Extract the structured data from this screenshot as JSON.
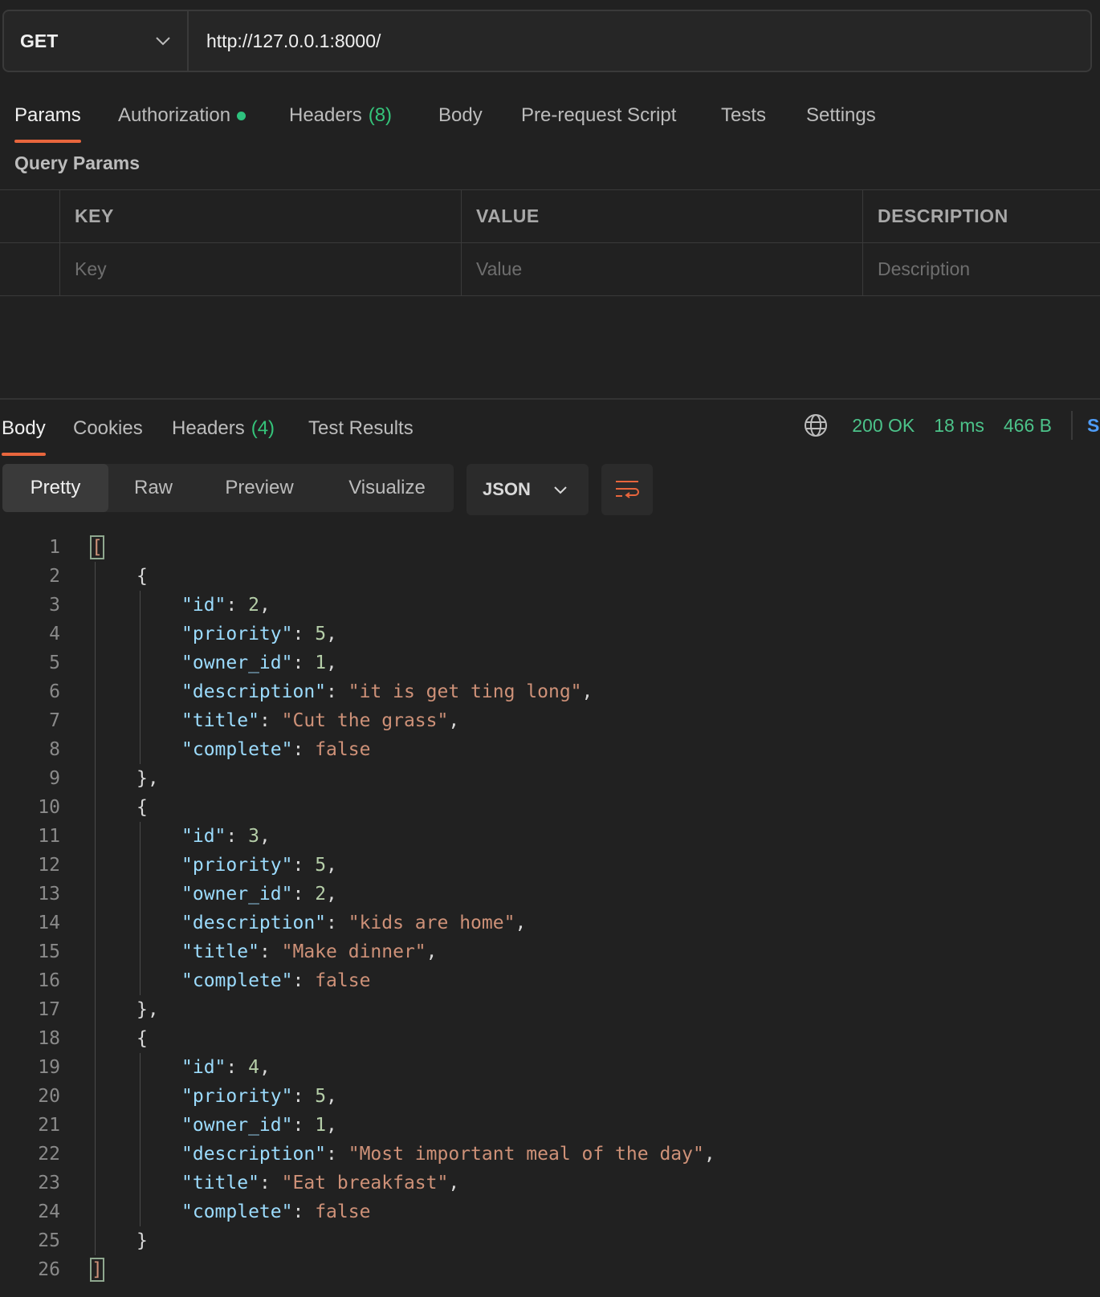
{
  "request": {
    "method": "GET",
    "url": "http://127.0.0.1:8000/"
  },
  "request_tabs": [
    {
      "label": "Params",
      "active": true
    },
    {
      "label": "Authorization",
      "dot": true
    },
    {
      "label": "Headers",
      "count": "(8)"
    },
    {
      "label": "Body"
    },
    {
      "label": "Pre-request Script"
    },
    {
      "label": "Tests"
    },
    {
      "label": "Settings"
    }
  ],
  "query_params": {
    "title": "Query Params",
    "columns": [
      "KEY",
      "VALUE",
      "DESCRIPTION"
    ],
    "placeholders": {
      "key": "Key",
      "value": "Value",
      "description": "Description"
    }
  },
  "response_tabs": [
    {
      "label": "Body",
      "active": true
    },
    {
      "label": "Cookies"
    },
    {
      "label": "Headers",
      "count": "(4)"
    },
    {
      "label": "Test Results"
    }
  ],
  "response_status": {
    "status": "200 OK",
    "time": "18 ms",
    "size": "466 B",
    "save": "S",
    "icon": "globe-icon"
  },
  "view_modes": [
    "Pretty",
    "Raw",
    "Preview",
    "Visualize"
  ],
  "active_view": "Pretty",
  "format": "JSON",
  "colors": {
    "accent": "#e8663d",
    "status_green": "#4cc38a",
    "key": "#9cdcfe",
    "number": "#b5cea8",
    "string": "#ce9178",
    "link": "#4f9cf6"
  },
  "response_body": [
    {
      "id": 2,
      "priority": 5,
      "owner_id": 1,
      "description": "it is get ting long",
      "title": "Cut the grass",
      "complete": "false"
    },
    {
      "id": 3,
      "priority": 5,
      "owner_id": 2,
      "description": "kids are home",
      "title": "Make dinner",
      "complete": "false"
    },
    {
      "id": 4,
      "priority": 5,
      "owner_id": 1,
      "description": "Most important meal of the day",
      "title": "Eat breakfast",
      "complete": "false"
    }
  ]
}
